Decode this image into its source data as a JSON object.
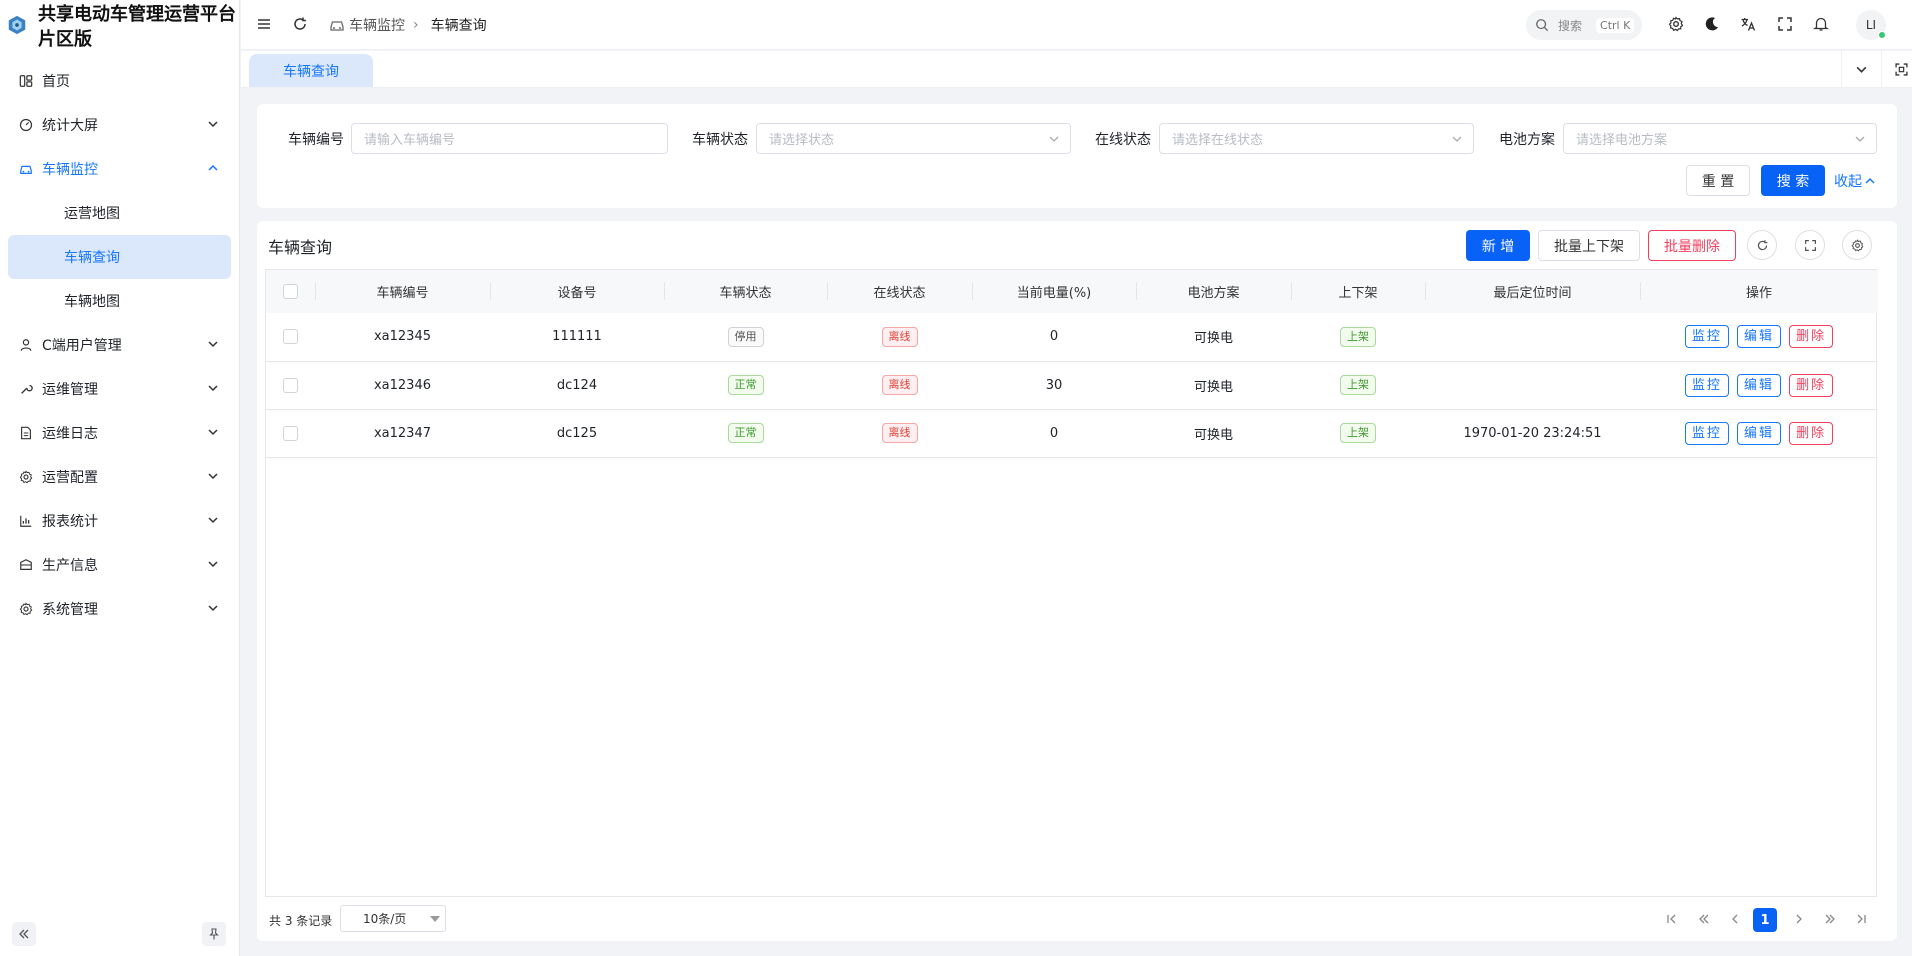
{
  "app": {
    "title_line1": "共享电动车管理运营平台",
    "title_line2": "片区版"
  },
  "sidebar": {
    "items": [
      {
        "label": "首页",
        "icon": "dashboard-icon"
      },
      {
        "label": "统计大屏",
        "icon": "gauge-icon"
      },
      {
        "label": "车辆监控",
        "icon": "car-icon"
      },
      {
        "label": "C端用户管理",
        "icon": "user-icon"
      },
      {
        "label": "运维管理",
        "icon": "wrench-icon"
      },
      {
        "label": "运维日志",
        "icon": "doc-icon"
      },
      {
        "label": "运营配置",
        "icon": "gear-icon"
      },
      {
        "label": "报表统计",
        "icon": "chart-icon"
      },
      {
        "label": "生产信息",
        "icon": "box-icon"
      },
      {
        "label": "系统管理",
        "icon": "gear-icon"
      }
    ],
    "submenu": [
      "运营地图",
      "车辆查询",
      "车辆地图"
    ]
  },
  "topbar": {
    "breadcrumb_parent": "车辆监控",
    "breadcrumb_current": "车辆查询",
    "search_placeholder": "搜索",
    "search_shortcut": "Ctrl K",
    "avatar_text": "LI"
  },
  "tabs": [
    {
      "label": "车辆查询"
    }
  ],
  "filters": {
    "vehicle_no_label": "车辆编号",
    "vehicle_no_placeholder": "请输入车辆编号",
    "vehicle_status_label": "车辆状态",
    "vehicle_status_placeholder": "请选择状态",
    "online_status_label": "在线状态",
    "online_status_placeholder": "请选择在线状态",
    "battery_label": "电池方案",
    "battery_placeholder": "请选择电池方案",
    "reset_label": "重 置",
    "search_label": "搜 索",
    "collapse_label": "收起"
  },
  "table_card": {
    "title": "车辆查询",
    "add_label": "新 增",
    "batch_shelf_label": "批量上下架",
    "batch_delete_label": "批量删除"
  },
  "table": {
    "columns": [
      "车辆编号",
      "设备号",
      "车辆状态",
      "在线状态",
      "当前电量(%)",
      "电池方案",
      "上下架",
      "最后定位时间",
      "操作"
    ],
    "rows": [
      {
        "vehicle_no": "xa12345",
        "device_no": "111111",
        "status": "停用",
        "online": "离线",
        "battery": "0",
        "scheme": "可换电",
        "shelf": "上架",
        "last_time": ""
      },
      {
        "vehicle_no": "xa12346",
        "device_no": "dc124",
        "status": "正常",
        "online": "离线",
        "battery": "30",
        "scheme": "可换电",
        "shelf": "上架",
        "last_time": ""
      },
      {
        "vehicle_no": "xa12347",
        "device_no": "dc125",
        "status": "正常",
        "online": "离线",
        "battery": "0",
        "scheme": "可换电",
        "shelf": "上架",
        "last_time": "1970-01-20 23:24:51"
      }
    ],
    "ops": {
      "monitor": "监控",
      "edit": "编辑",
      "delete": "删除"
    }
  },
  "pagination": {
    "total_text": "共 3 条记录",
    "page_size": "10条/页",
    "current_page": "1"
  },
  "colors": {
    "primary": "#0962f6",
    "danger": "#f0405e",
    "active_bg": "#dbe7fb"
  }
}
